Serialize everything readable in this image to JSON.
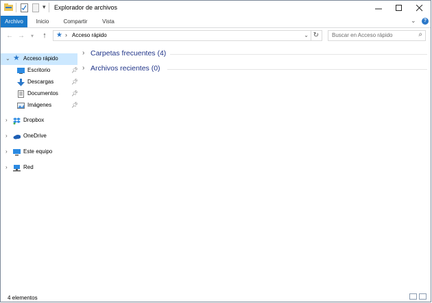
{
  "window": {
    "title": "Explorador de archivos"
  },
  "ribbon": {
    "tabs": [
      {
        "label": "Archivo",
        "active": true
      },
      {
        "label": "Inicio"
      },
      {
        "label": "Compartir"
      },
      {
        "label": "Vista"
      }
    ],
    "expand_glyph": "⌄",
    "help_glyph": "?"
  },
  "address": {
    "path": "Acceso rápido",
    "separator": "›",
    "search_placeholder": "Buscar en Acceso rápido"
  },
  "nav": {
    "items": [
      {
        "label": "Acceso rápido",
        "icon": "star-icon",
        "selected": true
      },
      {
        "label": "Escritorio",
        "icon": "desktop-icon",
        "pinned": true
      },
      {
        "label": "Descargas",
        "icon": "download-icon",
        "pinned": true
      },
      {
        "label": "Documentos",
        "icon": "documents-icon",
        "pinned": true
      },
      {
        "label": "Imágenes",
        "icon": "images-icon",
        "pinned": true
      },
      {
        "label": "Dropbox",
        "icon": "dropbox-icon"
      },
      {
        "label": "OneDrive",
        "icon": "onedrive-icon"
      },
      {
        "label": "Este equipo",
        "icon": "computer-icon"
      },
      {
        "label": "Red",
        "icon": "network-icon"
      }
    ]
  },
  "content": {
    "groups": [
      {
        "label": "Carpetas frecuentes (4)"
      },
      {
        "label": "Archivos recientes (0)"
      }
    ]
  },
  "status": {
    "text": "4 elementos"
  },
  "colors": {
    "accent": "#1979ca",
    "selected_bg": "#cce8ff",
    "group_header": "#1e3287"
  }
}
